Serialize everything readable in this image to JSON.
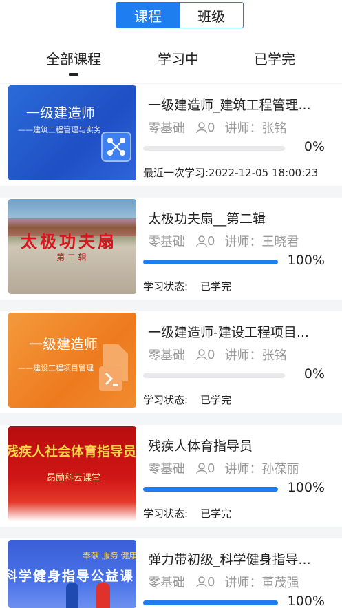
{
  "segment": {
    "active": "课程",
    "inactive": "班级"
  },
  "tabs": [
    "全部课程",
    "学习中",
    "已学完"
  ],
  "colors": {
    "accent": "#1e7ef0"
  },
  "courses": [
    {
      "title": "一级建造师_建筑工程管理...",
      "level": "零基础",
      "learners": "0",
      "lecturer": "讲师：张铭",
      "progress_percent": 0,
      "percent_label": "0%",
      "footer_label": "最近一次学习:2022-12-05 18:00:23",
      "footer_value": "",
      "thumb": {
        "heading": "一级建造师",
        "sub": "——建筑工程管理与实务"
      }
    },
    {
      "title": "太极功夫扇__第二辑",
      "level": "零基础",
      "learners": "0",
      "lecturer": "讲师：王晓君",
      "progress_percent": 100,
      "percent_label": "100%",
      "footer_label": "学习状态:",
      "footer_value": "已学完",
      "thumb": {
        "heading": "太极功夫扇",
        "sub": "第 二 辑"
      }
    },
    {
      "title": "一级建造师-建设工程项目...",
      "level": "零基础",
      "learners": "0",
      "lecturer": "讲师：张铭",
      "progress_percent": 0,
      "percent_label": "0%",
      "footer_label": "学习状态:",
      "footer_value": "已学完",
      "thumb": {
        "heading": "一级建造师",
        "sub": "——建设工程项目管理"
      }
    },
    {
      "title": "残疾人体育指导员",
      "level": "零基础",
      "learners": "0",
      "lecturer": "讲师：孙葆丽",
      "progress_percent": 100,
      "percent_label": "100%",
      "footer_label": "学习状态:",
      "footer_value": "已学完",
      "thumb": {
        "heading": "残疾人社会体育指导员培训",
        "sub": "昂励科云课堂"
      }
    },
    {
      "title": "弹力带初级_科学健身指导...",
      "level": "零基础",
      "learners": "0",
      "lecturer": "讲师：董茂强",
      "progress_percent": 100,
      "percent_label": "100%",
      "footer_label": "",
      "footer_value": "",
      "thumb": {
        "heading": "科学健身指导公益课",
        "sub": "奉献 服务 健康"
      }
    }
  ]
}
